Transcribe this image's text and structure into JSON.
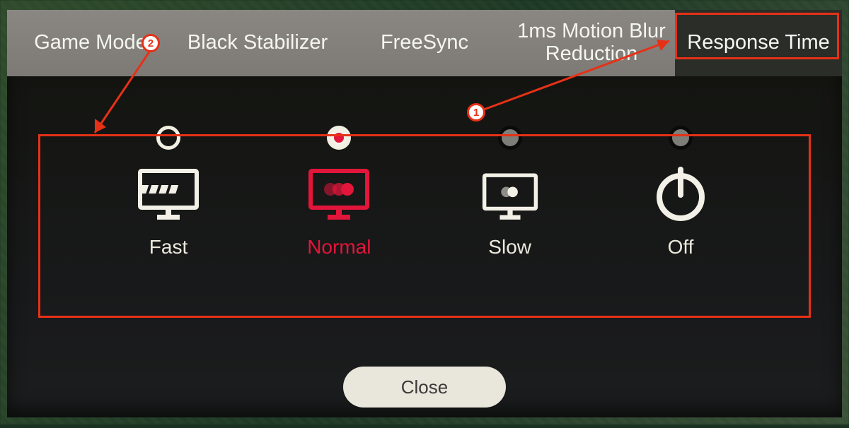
{
  "tabs": [
    {
      "label": "Game Mode",
      "active": false
    },
    {
      "label": "Black Stabilizer",
      "active": false
    },
    {
      "label": "FreeSync",
      "active": false
    },
    {
      "label": "1ms Motion Blur Reduction",
      "active": false
    },
    {
      "label": "Response Time",
      "active": true
    }
  ],
  "options": [
    {
      "label": "Fast",
      "selected": false,
      "icon": "monitor-fast",
      "radio_variant": "light"
    },
    {
      "label": "Normal",
      "selected": true,
      "icon": "monitor-normal",
      "radio_variant": "light"
    },
    {
      "label": "Slow",
      "selected": false,
      "icon": "monitor-slow",
      "radio_variant": "dark"
    },
    {
      "label": "Off",
      "selected": false,
      "icon": "power",
      "radio_variant": "dark"
    }
  ],
  "close_label": "Close",
  "annotations": {
    "marker1": "1",
    "marker2": "2"
  },
  "colors": {
    "accent": "#e2153a",
    "annotation": "#e63117"
  }
}
